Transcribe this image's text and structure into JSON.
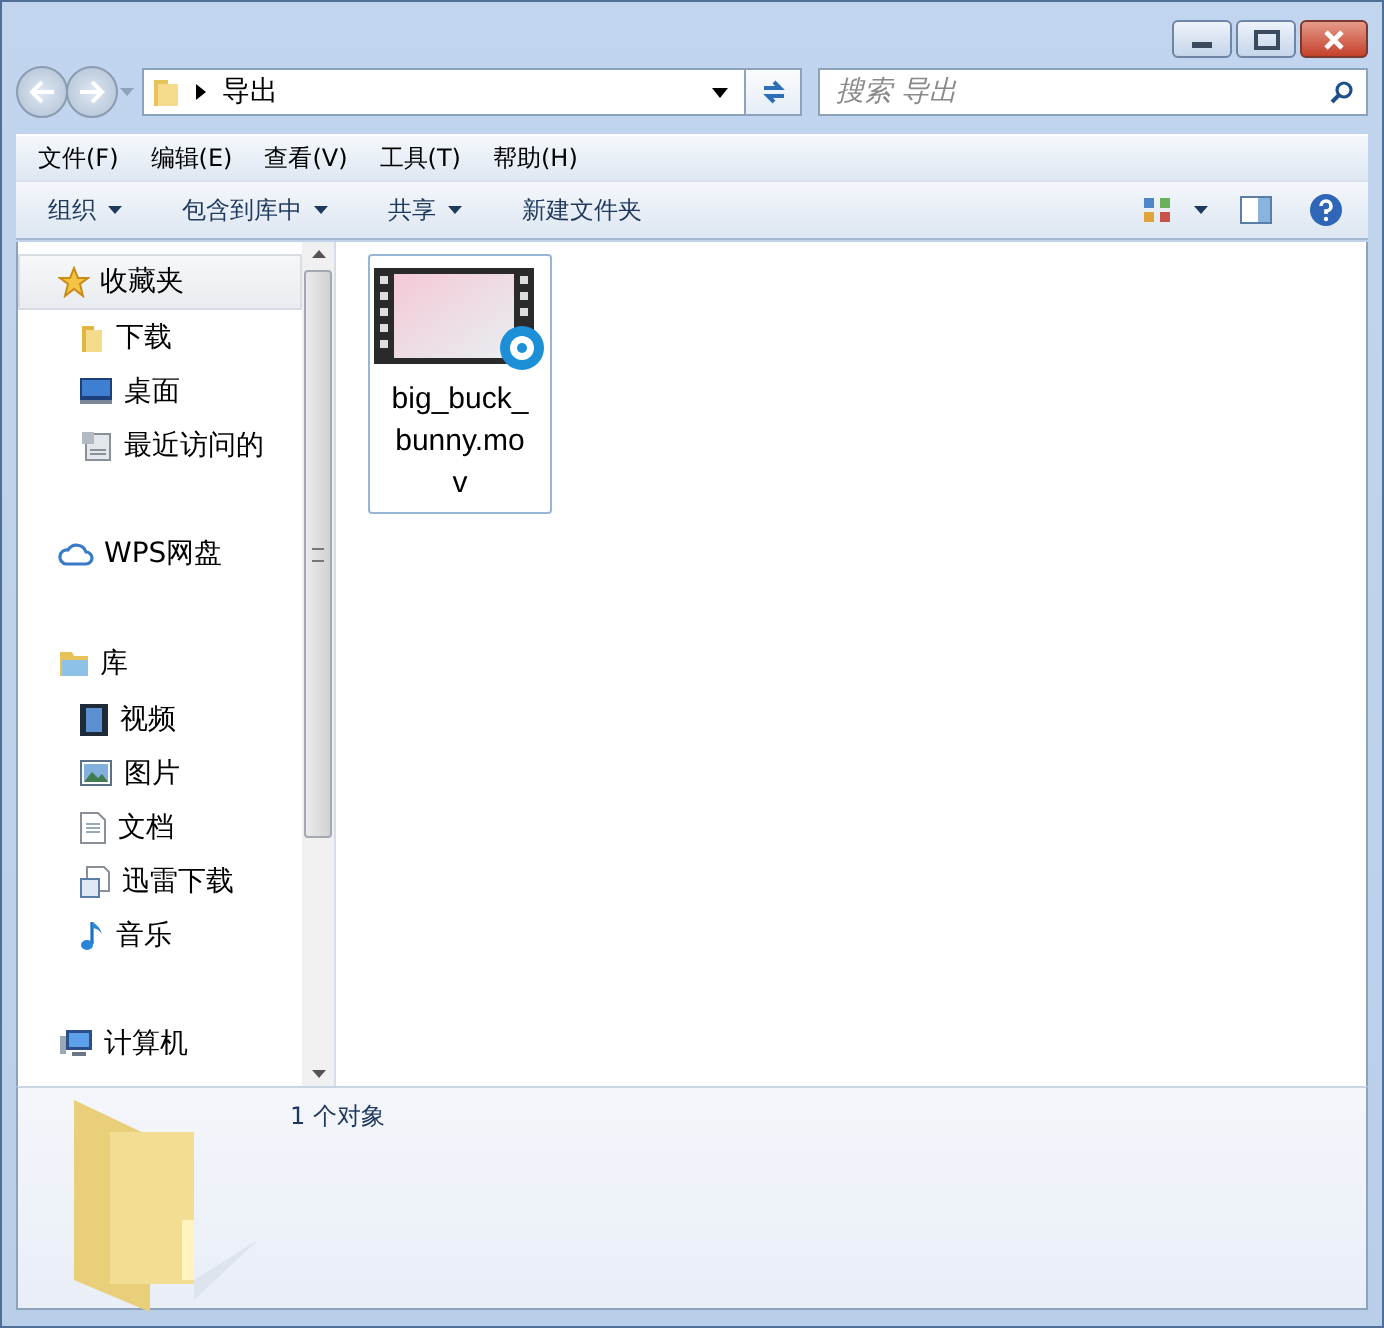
{
  "address": {
    "path": "导出"
  },
  "search": {
    "placeholder": "搜索 导出"
  },
  "menu": [
    "文件(F)",
    "编辑(E)",
    "查看(V)",
    "工具(T)",
    "帮助(H)"
  ],
  "toolbar": [
    {
      "label": "组织",
      "dropdown": true
    },
    {
      "label": "包含到库中",
      "dropdown": true
    },
    {
      "label": "共享",
      "dropdown": true
    },
    {
      "label": "新建文件夹",
      "dropdown": false
    }
  ],
  "sidebar": [
    {
      "label": "收藏夹",
      "kind": "favorites",
      "selected": true,
      "children": [
        {
          "label": "下载",
          "kind": "folder"
        },
        {
          "label": "桌面",
          "kind": "desktop"
        },
        {
          "label": "最近访问的",
          "kind": "recent"
        }
      ]
    },
    {
      "label": "WPS网盘",
      "kind": "cloud",
      "selected": false
    },
    {
      "label": "库",
      "kind": "library",
      "selected": false,
      "children": [
        {
          "label": "视频",
          "kind": "video"
        },
        {
          "label": "图片",
          "kind": "picture"
        },
        {
          "label": "文档",
          "kind": "document"
        },
        {
          "label": "迅雷下载",
          "kind": "download"
        },
        {
          "label": "音乐",
          "kind": "music"
        }
      ]
    },
    {
      "label": "计算机",
      "kind": "computer",
      "selected": false
    }
  ],
  "files": [
    {
      "name": "big_buck_bunny.mov",
      "selected": true
    }
  ],
  "details": {
    "count": "1 个对象"
  }
}
